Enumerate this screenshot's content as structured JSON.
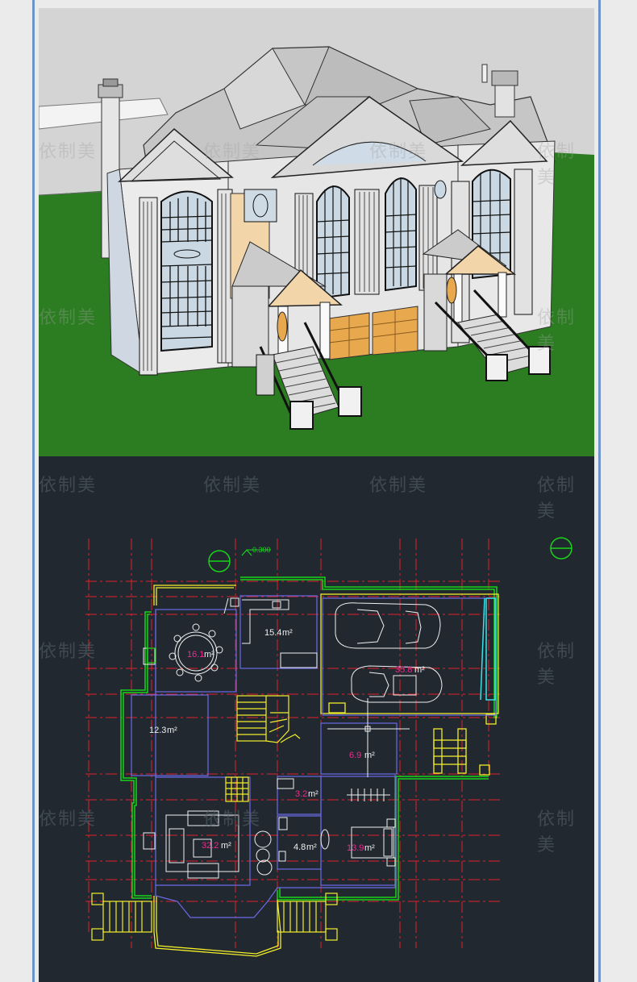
{
  "watermark": "依制美",
  "plan": {
    "elevation_mark": "-0.300",
    "rooms": [
      {
        "id": "dining",
        "area": "16.1",
        "unit": "m²"
      },
      {
        "id": "kitchen",
        "area": "15.4",
        "unit": "m²"
      },
      {
        "id": "garage",
        "area": "35.8",
        "unit": "m²"
      },
      {
        "id": "study",
        "area": "12.3",
        "unit": "m²"
      },
      {
        "id": "hall",
        "area": "6.9",
        "unit": "m²"
      },
      {
        "id": "wc",
        "area": "3.2",
        "unit": "m²"
      },
      {
        "id": "bath",
        "area": "4.8",
        "unit": "m²"
      },
      {
        "id": "living",
        "area": "32.2",
        "unit": "m²"
      },
      {
        "id": "bedroom",
        "area": "13.9",
        "unit": "m²"
      }
    ]
  },
  "colors": {
    "sky": "#d4d4d4",
    "grass": "#2c7d22",
    "cad_background": "#212830",
    "grid_red": "#e0202a",
    "wall_green": "#19d419",
    "wall_yellow": "#f2ee2a",
    "wall_white": "#f0f0f0",
    "outline_blue": "#6a6ae6",
    "cyan": "#3fe0e6",
    "magenta": "#ee2a8e",
    "frame": "#6e93c8"
  }
}
